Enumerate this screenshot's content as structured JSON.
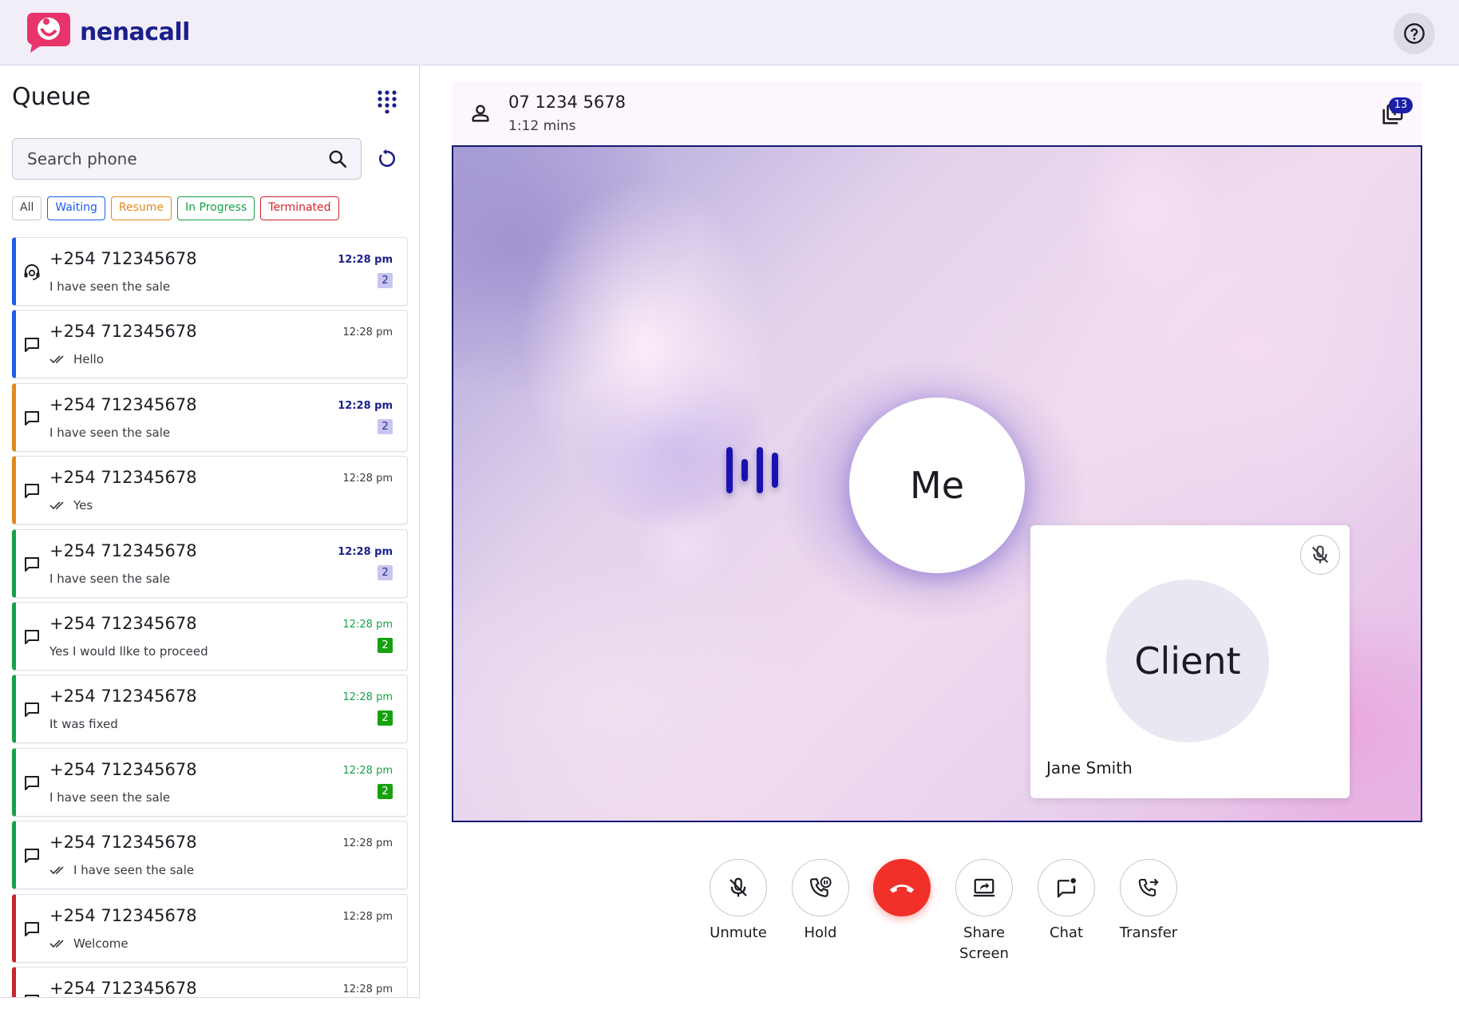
{
  "app": {
    "brand": "nenacall",
    "brand_color": "#1a1f8a",
    "accent_color": "#e8336b",
    "help_icon": "help-circle-icon"
  },
  "sidebar": {
    "title": "Queue",
    "dialpad_icon": "dialpad-icon",
    "search": {
      "placeholder": "Search phone",
      "value": ""
    },
    "filters": [
      {
        "label": "All",
        "color": "#3a3840"
      },
      {
        "label": "Waiting",
        "color": "#1e5ee8"
      },
      {
        "label": "Resume",
        "color": "#e08a1e"
      },
      {
        "label": "In Progress",
        "color": "#17a14a"
      },
      {
        "label": "Terminated",
        "color": "#d0262c"
      }
    ],
    "items": [
      {
        "phone": "+254 712345678",
        "message": "I have seen the sale",
        "time": "12:28 pm",
        "badge": "2"
      },
      {
        "phone": "+254 712345678",
        "message": "Hello",
        "time": "12:28 pm",
        "badge": ""
      },
      {
        "phone": "+254 712345678",
        "message": "I have seen the sale",
        "time": "12:28 pm",
        "badge": "2"
      },
      {
        "phone": "+254 712345678",
        "message": "Yes",
        "time": "12:28 pm",
        "badge": ""
      },
      {
        "phone": "+254 712345678",
        "message": "I have seen the sale",
        "time": "12:28 pm",
        "badge": "2"
      },
      {
        "phone": "+254 712345678",
        "message": "Yes I would llke to proceed",
        "time": "12:28 pm",
        "badge": "2"
      },
      {
        "phone": "+254 712345678",
        "message": "It was fixed",
        "time": "12:28 pm",
        "badge": "2"
      },
      {
        "phone": "+254 712345678",
        "message": "I have seen the sale",
        "time": "12:28 pm",
        "badge": "2"
      },
      {
        "phone": "+254 712345678",
        "message": "I have seen the sale",
        "time": "12:28 pm",
        "badge": ""
      },
      {
        "phone": "+254 712345678",
        "message": "Welcome",
        "time": "12:28 pm",
        "badge": ""
      },
      {
        "phone": "+254 712345678",
        "message": "",
        "time": "12:28 pm",
        "badge": ""
      }
    ]
  },
  "call": {
    "number": "07 1234 5678",
    "duration": "1:12 mins",
    "participants_count": "13",
    "me_label": "Me",
    "client_label": "Client",
    "client_name": "Jane Smith",
    "stage_border_color": "#141a6e"
  },
  "controls": {
    "unmute": "Unmute",
    "hold": "Hold",
    "share_screen_line1": "Share",
    "share_screen_line2": "Screen",
    "chat": "Chat",
    "transfer": "Transfer",
    "hangup_color": "#f2302a"
  }
}
